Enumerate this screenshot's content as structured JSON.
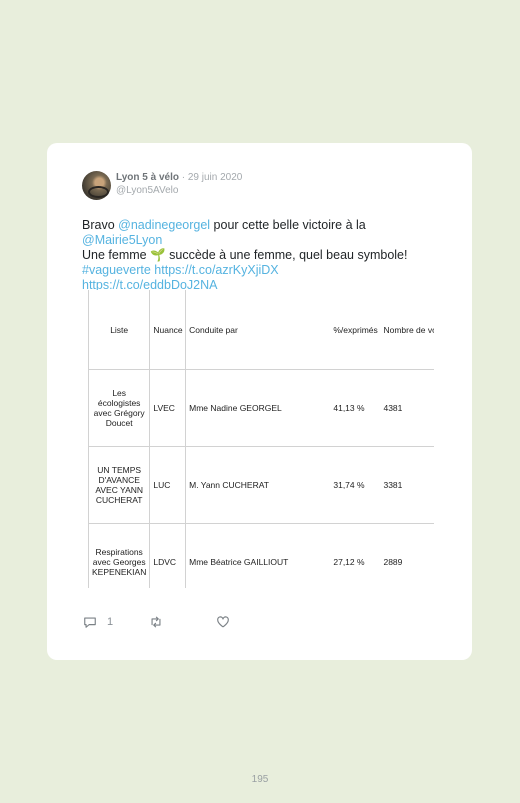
{
  "tweet": {
    "author_name": "Lyon 5 à vélo",
    "date": "· 29 juin 2020",
    "handle": "@Lyon5AVelo",
    "text": {
      "p1": "Bravo ",
      "mention1": "@nadinegeorgel",
      "p2": " pour cette belle victoire à la ",
      "mention2": "@Mairie5Lyon",
      "p3": "Une femme ",
      "emoji": "🌱",
      "p4": " succède à une femme, quel beau symbole!",
      "hashtag": "#vagueverte",
      "link1": "https://t.co/azrKyXjiDX",
      "link2": "https://t.co/eddbDoJ2NA"
    },
    "reply_count": "1"
  },
  "results_table": {
    "headers": {
      "liste": "Liste",
      "nuance": "Nuance",
      "conduite": "Conduite par",
      "exprimes": "%/exprimés",
      "voix": "Nombre de voix"
    },
    "rows": [
      {
        "liste": "Les écologistes avec Grégory Doucet",
        "nuance": "LVEC",
        "conduite": "Mme Nadine GEORGEL",
        "exprimes": "41,13 %",
        "voix": "4381"
      },
      {
        "liste": "UN TEMPS D'AVANCE AVEC YANN CUCHERAT",
        "nuance": "LUC",
        "conduite": "M. Yann CUCHERAT",
        "exprimes": "31,74 %",
        "voix": "3381"
      },
      {
        "liste": "Respirations avec Georges KEPENEKIAN",
        "nuance": "LDVC",
        "conduite": "Mme Béatrice GAILLIOUT",
        "exprimes": "27,12 %",
        "voix": "2889"
      }
    ]
  },
  "page_number": "195",
  "colors": {
    "background": "#e8eedc",
    "link": "#55b3e0",
    "card": "#ffffff"
  },
  "icons": [
    "reply-icon",
    "retweet-icon",
    "like-icon"
  ]
}
